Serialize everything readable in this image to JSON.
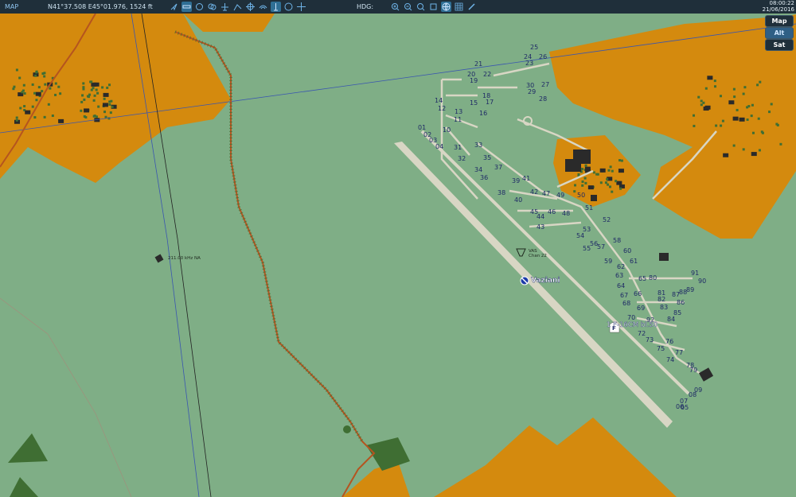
{
  "topbar": {
    "mode_label": "MAP",
    "coords": "N41°37.508 E45°01.976, 1524 ft",
    "hdg_label": "HDG:",
    "time": "08:00:22",
    "date": "21/06/2016"
  },
  "map_buttons": {
    "map": "Map",
    "alt": "Alt",
    "sat": "Sat"
  },
  "icons": {
    "left_toolbar": [
      "cursor-icon",
      "ruler-icon",
      "circle-icon",
      "layers-icon",
      "aircraft-icon",
      "route-icon",
      "target-icon",
      "signal-icon",
      "tower-icon",
      "chat-icon",
      "move-icon"
    ],
    "right_toolbar": [
      "zoom-in-icon",
      "zoom-out-icon",
      "zoom-fit-icon",
      "zoom-area-icon",
      "globe-icon",
      "grid-icon",
      "pen-icon"
    ]
  },
  "airbase": {
    "name": "Vaziani",
    "vas_label": "VAS",
    "channel_label": "Chan 22",
    "unit_label": "1 F-16CM bl.50",
    "unit_marker": "F"
  },
  "beacon": {
    "label": "211.00 kHz NA"
  },
  "parking_spots": [
    "01",
    "02",
    "03",
    "04",
    "05",
    "06",
    "07",
    "08",
    "09",
    "10",
    "11",
    "12",
    "13",
    "14",
    "15",
    "16",
    "17",
    "18",
    "19",
    "20",
    "21",
    "22",
    "23",
    "24",
    "25",
    "26",
    "27",
    "28",
    "29",
    "30",
    "31",
    "32",
    "33",
    "34",
    "35",
    "36",
    "37",
    "38",
    "39",
    "40",
    "41",
    "42",
    "43",
    "44",
    "45",
    "46",
    "47",
    "48",
    "49",
    "50",
    "51",
    "52",
    "53",
    "54",
    "55",
    "56",
    "57",
    "58",
    "59",
    "60",
    "61",
    "62",
    "63",
    "64",
    "65",
    "66",
    "67",
    "68",
    "69",
    "70",
    "72",
    "73",
    "74",
    "75",
    "76",
    "77",
    "78",
    "79",
    "80",
    "81",
    "82",
    "83",
    "84",
    "85",
    "86",
    "87",
    "88",
    "89",
    "90",
    "91",
    "92"
  ],
  "colors": {
    "terrain": "#7fae86",
    "urban": "#d48a0e",
    "road": "#b5541f",
    "airfield": "#d8d6c4",
    "label": "#1f2a66",
    "topbar": "#1f2f3a"
  }
}
